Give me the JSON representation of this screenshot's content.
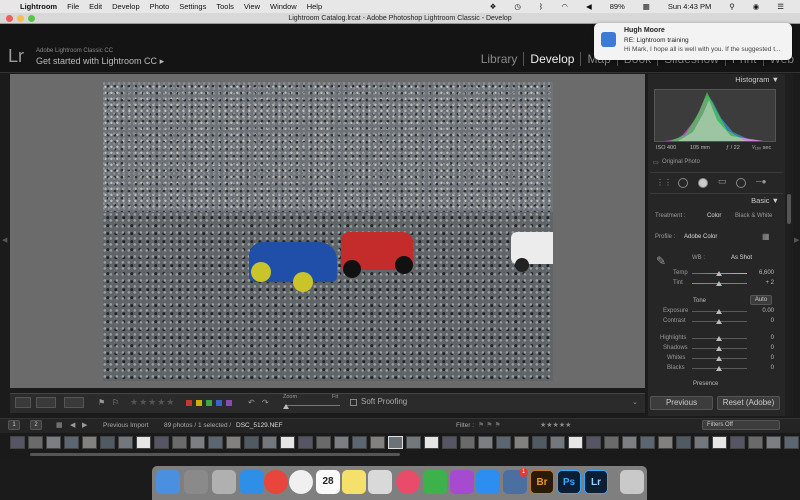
{
  "menubar": {
    "app_name": "Lightroom",
    "items": [
      "File",
      "Edit",
      "Develop",
      "Photo",
      "Settings",
      "Tools",
      "View",
      "Window",
      "Help"
    ],
    "battery": "89%",
    "clock": "Sun 4:43 PM"
  },
  "window": {
    "title": "Lightroom Catalog.lrcat - Adobe Photoshop Lightroom Classic - Develop"
  },
  "identity": {
    "logo": "Lr",
    "product": "Adobe Lightroom Classic CC",
    "tagline": "Get started with Lightroom CC",
    "tagline_arrow": "▸"
  },
  "modules": [
    "Library",
    "Develop",
    "Map",
    "Book",
    "Slideshow",
    "Print",
    "Web"
  ],
  "active_module": "Develop",
  "notification": {
    "sender": "Hugh Moore",
    "subject": "RE: Lightroom training",
    "preview": "Hi Mark, I hope all is well with you. If the suggested t..."
  },
  "histogram": {
    "header": "Histogram",
    "iso": "ISO 400",
    "focal": "105 mm",
    "aperture": "ƒ / 22",
    "shutter": "¹⁄₁₆₀ sec",
    "original_label": "Original Photo"
  },
  "basic": {
    "header": "Basic",
    "treatment_label": "Treatment :",
    "treatment_color": "Color",
    "treatment_bw": "Black & White",
    "profile_label": "Profile :",
    "profile_value": "Adobe Color",
    "wb_label": "WB :",
    "wb_value": "As Shot",
    "temp_label": "Temp",
    "temp_value": "6,600",
    "tint_label": "Tint",
    "tint_value": "+ 2",
    "tone_label": "Tone",
    "auto_label": "Auto",
    "sliders": [
      {
        "label": "Exposure",
        "value": "0.00"
      },
      {
        "label": "Contrast",
        "value": "0"
      },
      {
        "label": "Highlights",
        "value": "0"
      },
      {
        "label": "Shadows",
        "value": "0"
      },
      {
        "label": "Whites",
        "value": "0"
      },
      {
        "label": "Blacks",
        "value": "0"
      }
    ],
    "presence_label": "Presence"
  },
  "panel_buttons": {
    "previous": "Previous",
    "reset": "Reset (Adobe)"
  },
  "toolbar": {
    "zoom_label": "Zoom",
    "fit_label": "Fit",
    "soft_proofing": "Soft Proofing"
  },
  "filmstrip": {
    "page1": "1",
    "page2": "2",
    "source": "Previous Import",
    "count": "89 photos / 1 selected /",
    "filename": "DSC_5129.NEF",
    "filter_label": "Filter :",
    "filters_off": "Filters Off"
  },
  "dock": {
    "calendar_day": "28",
    "badge": "1",
    "br": "Br",
    "ps": "Ps",
    "lr": "Lr"
  },
  "colors": {
    "accent_label_red": "#c0392b",
    "accent_label_yellow": "#c8b400",
    "accent_label_green": "#3aa84a",
    "accent_label_blue": "#3466c8",
    "accent_label_purple": "#8a4ab5"
  }
}
